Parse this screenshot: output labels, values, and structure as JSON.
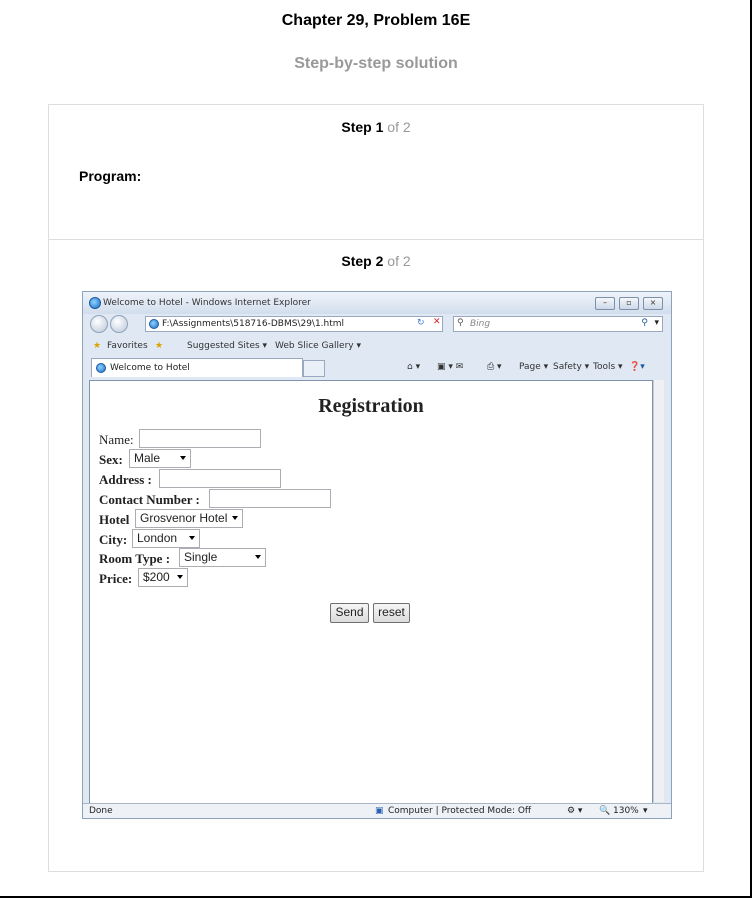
{
  "page": {
    "title": "Chapter 29, Problem 16E",
    "subtitle": "Step-by-step solution"
  },
  "steps": [
    {
      "label": "Step",
      "num": "1",
      "of": "of 2",
      "text": "Program:"
    },
    {
      "label": "Step",
      "num": "2",
      "of": "of 2"
    }
  ],
  "browser": {
    "window_title": "Welcome to Hotel - Windows Internet Explorer",
    "address": "F:\\Assignments\\518716-DBMS\\29\\1.html",
    "search_placeholder": "Bing",
    "favorites": "Favorites",
    "suggested_sites": "Suggested Sites ▾",
    "web_slice_gallery": "Web Slice Gallery ▾",
    "tab_label": "Welcome to Hotel",
    "cmd_page": "Page ▾",
    "cmd_safety": "Safety ▾",
    "cmd_tools": "Tools ▾",
    "status_left": "Done",
    "status_zone": "Computer | Protected Mode: Off",
    "zoom": "130%"
  },
  "form": {
    "heading": "Registration",
    "name_label": "Name:",
    "sex_label": "Sex:",
    "sex_value": "Male",
    "address_label": "Address :",
    "contact_label": "Contact Number :",
    "hotel_label": "Hotel",
    "hotel_value": "Grosvenor Hotel",
    "city_label": "City:",
    "city_value": "London",
    "room_label": "Room Type :",
    "room_value": "Single",
    "price_label": "Price:",
    "price_value": "$200",
    "send": "Send",
    "reset": "reset"
  }
}
